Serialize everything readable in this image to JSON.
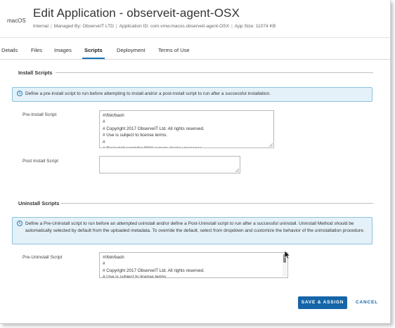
{
  "header": {
    "platform": "macOS",
    "title": "Edit Application - observeit-agent-OSX",
    "meta": {
      "type": "Internal",
      "managed_by": "Managed By: ObserveIT LTD",
      "application_id": "Application ID: com.vmw.macos.observeit-agent-OSX",
      "app_size": "App Size: 11074 KB"
    }
  },
  "tabs": [
    {
      "label": "Details"
    },
    {
      "label": "Files"
    },
    {
      "label": "Images"
    },
    {
      "label": "Scripts",
      "active": true
    },
    {
      "label": "Deployment"
    },
    {
      "label": "Terms of Use"
    }
  ],
  "install": {
    "section_title": "Install Scripts",
    "info": "Define a pre-install script to run before attempting to install and/or a post-install script to run after a successful installation.",
    "pre_label": "Pre-Install Script",
    "pre_lines": [
      "#!/bin/bash",
      "#",
      "# Copyright 2017 ObserveIT Ltd.  All rights reserved.",
      "# Use is subject to license terms.",
      "#",
      "# Preinstall script for OSX remote deploy manager"
    ],
    "post_label": "Post Install Script",
    "post_value": ""
  },
  "uninstall": {
    "section_title": "Uninstall Scripts",
    "info": "Define a Pre-Uninstall script to run before an attempted uninstall and/or define a Post-Uninstall script to run after a successful uninstall. Uninstall Method should be automatically selected by default from the uploaded metadata. To override the default, select from dropdown and customize the behavior of the uninstallation procedure.",
    "pre_label": "Pre-Uninstall Script",
    "pre_lines": [
      "#!/bin/bash",
      "#",
      "# Copyright 2017 ObserveIT Ltd.  All rights reserved.",
      "# Use is subject to license terms."
    ]
  },
  "actions": {
    "save_label": "SAVE & ASSIGN",
    "cancel_label": "CANCEL"
  },
  "icons": {
    "info": "info-circle-icon",
    "cursor": "mouse-pointer-icon"
  },
  "colors": {
    "accent": "#1565a8",
    "info_bg": "#e4f1f8",
    "info_border": "#8dc2de"
  }
}
